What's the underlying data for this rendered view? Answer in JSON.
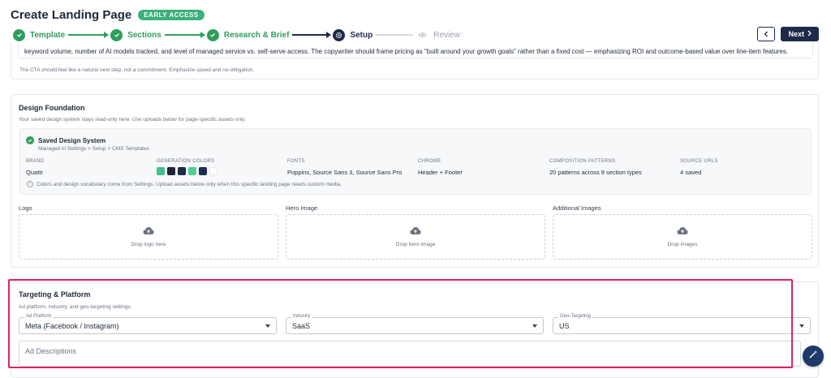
{
  "header": {
    "title": "Create Landing Page",
    "badge": "EARLY ACCESS",
    "steps": [
      {
        "label": "Template",
        "state": "done"
      },
      {
        "label": "Sections",
        "state": "done"
      },
      {
        "label": "Research & Brief",
        "state": "done"
      },
      {
        "label": "Setup",
        "state": "active"
      },
      {
        "label": "Review",
        "state": "pending"
      }
    ],
    "next_label": "Next"
  },
  "brief": {
    "text": "keyword volume, number of AI models tracked, and level of managed service vs. self-serve access. The copywriter should frame pricing as \"built around your growth goals\" rather than a fixed cost — emphasizing ROI and outcome-based value over line-item features.",
    "cta_note": "The CTA should feel like a natural next step, not a commitment. Emphasize speed and no-obligation."
  },
  "design": {
    "title": "Design Foundation",
    "subtitle": "Your saved design system stays read-only here. Use uploads below for page-specific assets only.",
    "saved_title": "Saved Design System",
    "saved_sub": "Managed in Settings > Setup > CMS Templates",
    "brand_label": "BRAND",
    "brand_value": "Quattr",
    "colors_label": "GENERATION COLORS",
    "colors": [
      "#45c08a",
      "#1f2433",
      "#1e2a4a",
      "#4fcf94",
      "#1e2d55",
      "#ffffff"
    ],
    "fonts_label": "FONTS",
    "fonts_value": "Poppins, Source Sans 3, Source Sans Pro",
    "chrome_label": "CHROME",
    "chrome_value": "Header + Footer",
    "patterns_label": "COMPOSITION PATTERNS",
    "patterns_value": "20 patterns across 9 section types",
    "sources_label": "SOURCE URLS",
    "sources_value": "4 saved",
    "note": "Colors and design vocabulary come from Settings. Upload assets below only when this specific landing page needs custom media.",
    "uploads": [
      {
        "label": "Logo",
        "drop": "Drop logo here"
      },
      {
        "label": "Hero Image",
        "drop": "Drop hero image"
      },
      {
        "label": "Additional Images",
        "drop": "Drop images"
      }
    ]
  },
  "targeting": {
    "title": "Targeting & Platform",
    "subtitle": "Ad platform, industry, and geo-targeting settings.",
    "ad_platform_label": "Ad Platform",
    "ad_platform_value": "Meta (Facebook / Instagram)",
    "industry_label": "Industry",
    "industry_value": "SaaS",
    "geo_label": "Geo-Targeting",
    "geo_value": "US",
    "descriptions_placeholder": "Ad Descriptions"
  }
}
